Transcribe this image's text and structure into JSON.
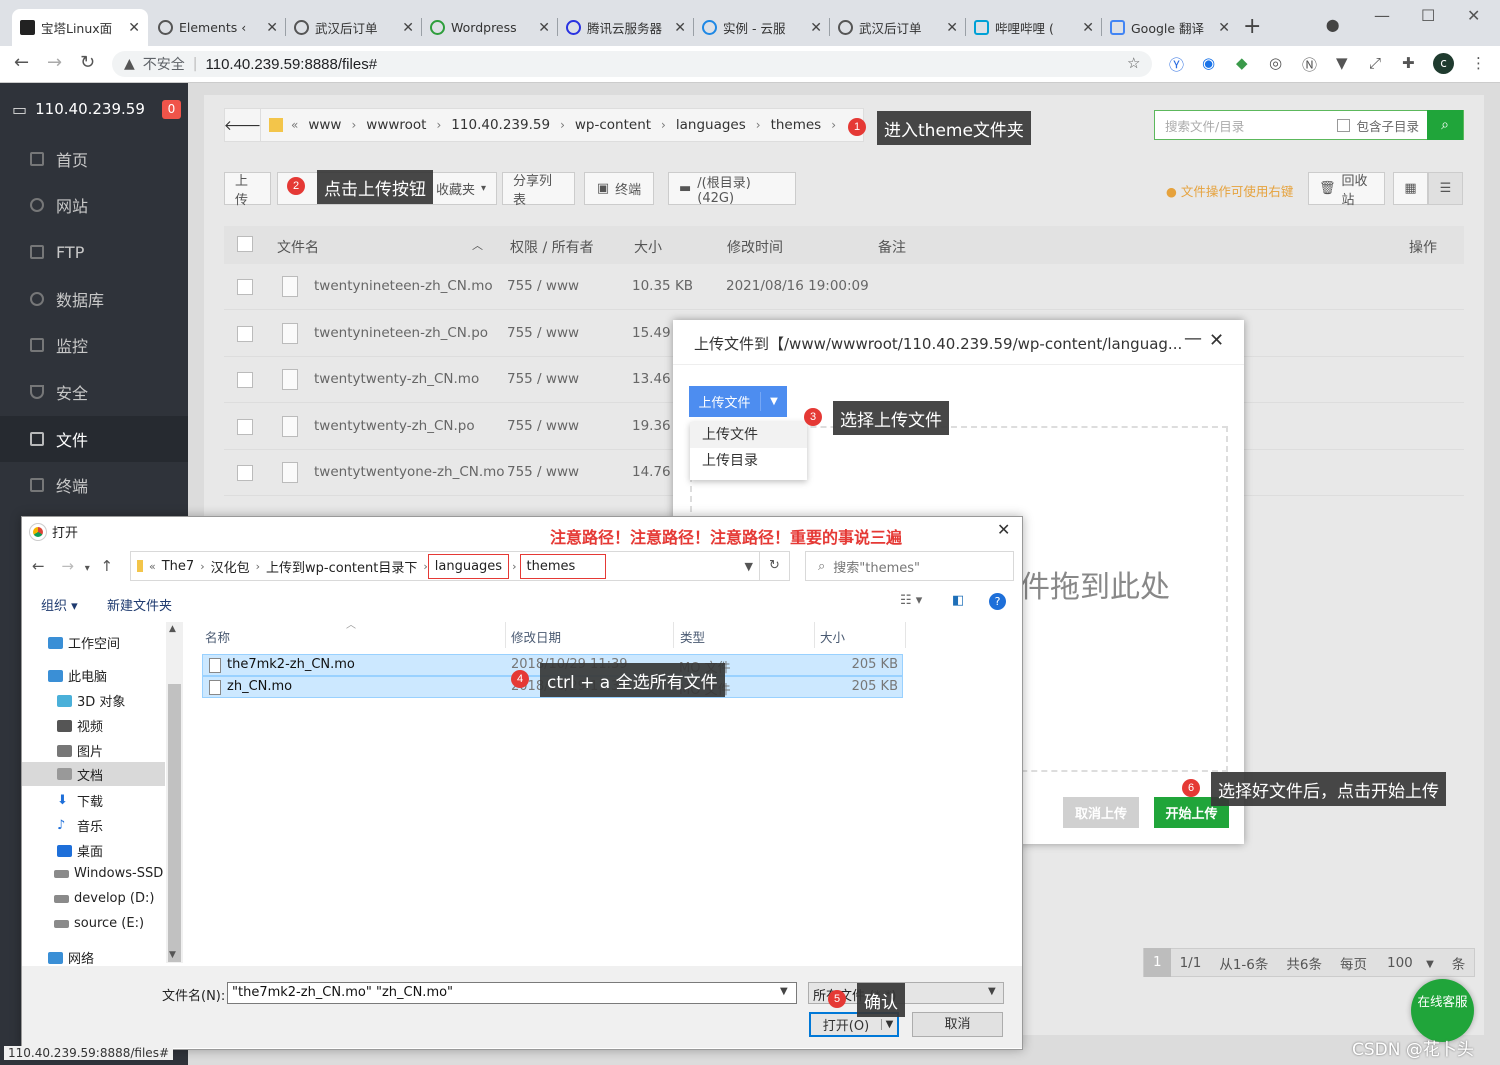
{
  "browser": {
    "tabs": [
      {
        "label": "宝塔Linux面"
      },
      {
        "label": "Elements ‹"
      },
      {
        "label": "武汉后订单"
      },
      {
        "label": "Wordpress"
      },
      {
        "label": "腾讯云服务器"
      },
      {
        "label": "实例 - 云服"
      },
      {
        "label": "武汉后订单"
      },
      {
        "label": "哔哩哔哩 ("
      },
      {
        "label": "Google 翻译"
      }
    ],
    "insecure_label": "不安全",
    "url": "110.40.239.59:8888/files#",
    "profile_initial": "c",
    "status_url": "110.40.239.59:8888/files#"
  },
  "sidebar": {
    "server_ip": "110.40.239.59",
    "badge": "0",
    "items": [
      {
        "label": "首页"
      },
      {
        "label": "网站"
      },
      {
        "label": "FTP"
      },
      {
        "label": "数据库"
      },
      {
        "label": "监控"
      },
      {
        "label": "安全"
      },
      {
        "label": "文件"
      },
      {
        "label": "终端"
      }
    ]
  },
  "filemanager": {
    "breadcrumb": [
      "www",
      "wwwroot",
      "110.40.239.59",
      "wp-content",
      "languages",
      "themes"
    ],
    "search_placeholder": "搜索文件/目录",
    "include_subdir": "包含子目录",
    "toolbar": {
      "upload": "上传",
      "favorites": "收藏夹",
      "share_list": "分享列表",
      "terminal": "终端",
      "disk": "/(根目录) (42G)",
      "tip": "文件操作可使用右键",
      "recycle": "回收站"
    },
    "columns": {
      "name": "文件名",
      "perm": "权限 / 所有者",
      "size": "大小",
      "mtime": "修改时间",
      "note": "备注",
      "ops": "操作"
    },
    "rows": [
      {
        "name": "twentynineteen-zh_CN.mo",
        "perm": "755 / www",
        "size": "10.35 KB",
        "mtime": "2021/08/16 19:00:09"
      },
      {
        "name": "twentynineteen-zh_CN.po",
        "perm": "755 / www",
        "size": "15.49 K",
        "mtime": ""
      },
      {
        "name": "twentytwenty-zh_CN.mo",
        "perm": "755 / www",
        "size": "13.46 K",
        "mtime": ""
      },
      {
        "name": "twentytwenty-zh_CN.po",
        "perm": "755 / www",
        "size": "19.36 K",
        "mtime": ""
      },
      {
        "name": "twentytwentyone-zh_CN.mo",
        "perm": "755 / www",
        "size": "14.76 K",
        "mtime": ""
      }
    ],
    "pager": {
      "page": "1",
      "pages": "1/1",
      "range": "从1-6条",
      "total": "共6条",
      "per_page_label": "每页",
      "per_page": "100",
      "unit": "条"
    }
  },
  "upload_modal": {
    "title": "上传文件到【/www/wwwroot/110.40.239.59/wp-content/languag...",
    "upload_button": "上传文件",
    "menu": [
      "上传文件",
      "上传目录"
    ],
    "drop_text": "件拖到此处",
    "cancel_upload": "取消上传",
    "start_upload": "开始上传"
  },
  "open_dialog": {
    "title": "打开",
    "warning": "注意路径！注意路径！注意路径！重要的事说三遍",
    "path": [
      "The7",
      "汉化包",
      "上传到wp-content目录下",
      "languages",
      "themes"
    ],
    "search_placeholder": "搜索\"themes\"",
    "organize": "组织 ▾",
    "new_folder": "新建文件夹",
    "tree": [
      {
        "label": "工作空间"
      },
      {
        "label": "此电脑"
      },
      {
        "label": "3D 对象"
      },
      {
        "label": "视频"
      },
      {
        "label": "图片"
      },
      {
        "label": "文档"
      },
      {
        "label": "下载"
      },
      {
        "label": "音乐"
      },
      {
        "label": "桌面"
      },
      {
        "label": "Windows-SSD ("
      },
      {
        "label": "develop (D:)"
      },
      {
        "label": "source (E:)"
      },
      {
        "label": "网络"
      }
    ],
    "columns": {
      "name": "名称",
      "date": "修改日期",
      "type": "类型",
      "size": "大小"
    },
    "files": [
      {
        "name": "the7mk2-zh_CN.mo",
        "date": "2018/10/29 11:39",
        "type": "MO 文件",
        "size": "205 KB"
      },
      {
        "name": "zh_CN.mo",
        "date": "2018/10/29 11:39",
        "type": "MO 文件",
        "size": "205 KB"
      }
    ],
    "filename_label": "文件名(N):",
    "filename_value": "\"the7mk2-zh_CN.mo\" \"zh_CN.mo\"",
    "filetype": "所有文件 (*.*)",
    "open_button": "打开(O)",
    "cancel_button": "取消"
  },
  "annotations": [
    {
      "num": "1",
      "text": "进入theme文件夹"
    },
    {
      "num": "2",
      "text": "点击上传按钮"
    },
    {
      "num": "3",
      "text": "选择上传文件"
    },
    {
      "num": "4",
      "text": "ctrl + a 全选所有文件"
    },
    {
      "num": "5",
      "text": "确认"
    },
    {
      "num": "6",
      "text": "选择好文件后，点击开始上传"
    }
  ],
  "online_service": "在线客服",
  "watermark": "CSDN @花卜头",
  "colors": {
    "brand_green": "#20a53a",
    "sidebar_bg": "#2f333a",
    "upload_blue": "#4d8df0",
    "annotation_red": "#e53935"
  }
}
